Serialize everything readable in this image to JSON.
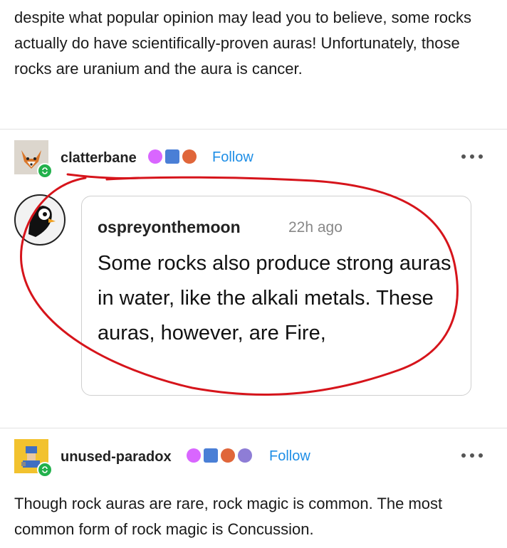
{
  "top_post": {
    "text": "despite what popular opinion may lead you to believe, some rocks actually do have scientifically-proven auras! Unfortunately, those rocks are uranium and the aura is cancer."
  },
  "reblog_1": {
    "username": "clatterbane",
    "follow_label": "Follow",
    "badge_colors": [
      "#d966ff",
      "#4a7fd6",
      "#e0663a"
    ]
  },
  "quote": {
    "username": "ospreyonthemoon",
    "time": "22h ago",
    "text": "Some rocks also produce strong auras in water, like the alkali metals. These auras, however, are Fire,"
  },
  "reblog_2": {
    "username": "unused-paradox",
    "follow_label": "Follow",
    "badge_colors": [
      "#d966ff",
      "#4a7fd6",
      "#e0663a",
      "#8e7dd6"
    ],
    "text": "Though rock auras are rare, rock magic is common. The most common form of rock magic is Concussion."
  },
  "colors": {
    "link": "#1e8ee6",
    "annotation": "#d6141b",
    "reblog_badge": "#22b14c"
  }
}
